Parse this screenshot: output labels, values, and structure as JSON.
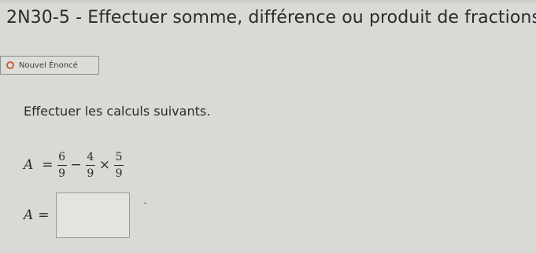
{
  "header": {
    "title": "2N30-5 - Effectuer somme, différence ou produit de fractions"
  },
  "toolbar": {
    "new_statement_label": "Nouvel Énoncé",
    "new_statement_icon": "refresh-icon"
  },
  "exercise": {
    "instruction": "Effectuer les calculs suivants.",
    "variable": "A",
    "equals": "=",
    "terms": [
      {
        "numerator": "6",
        "denominator": "9"
      },
      {
        "numerator": "4",
        "denominator": "9"
      },
      {
        "numerator": "5",
        "denominator": "9"
      }
    ],
    "operators": [
      "−",
      "×"
    ],
    "answer": {
      "variable": "A",
      "equals": "=",
      "value": ""
    }
  }
}
